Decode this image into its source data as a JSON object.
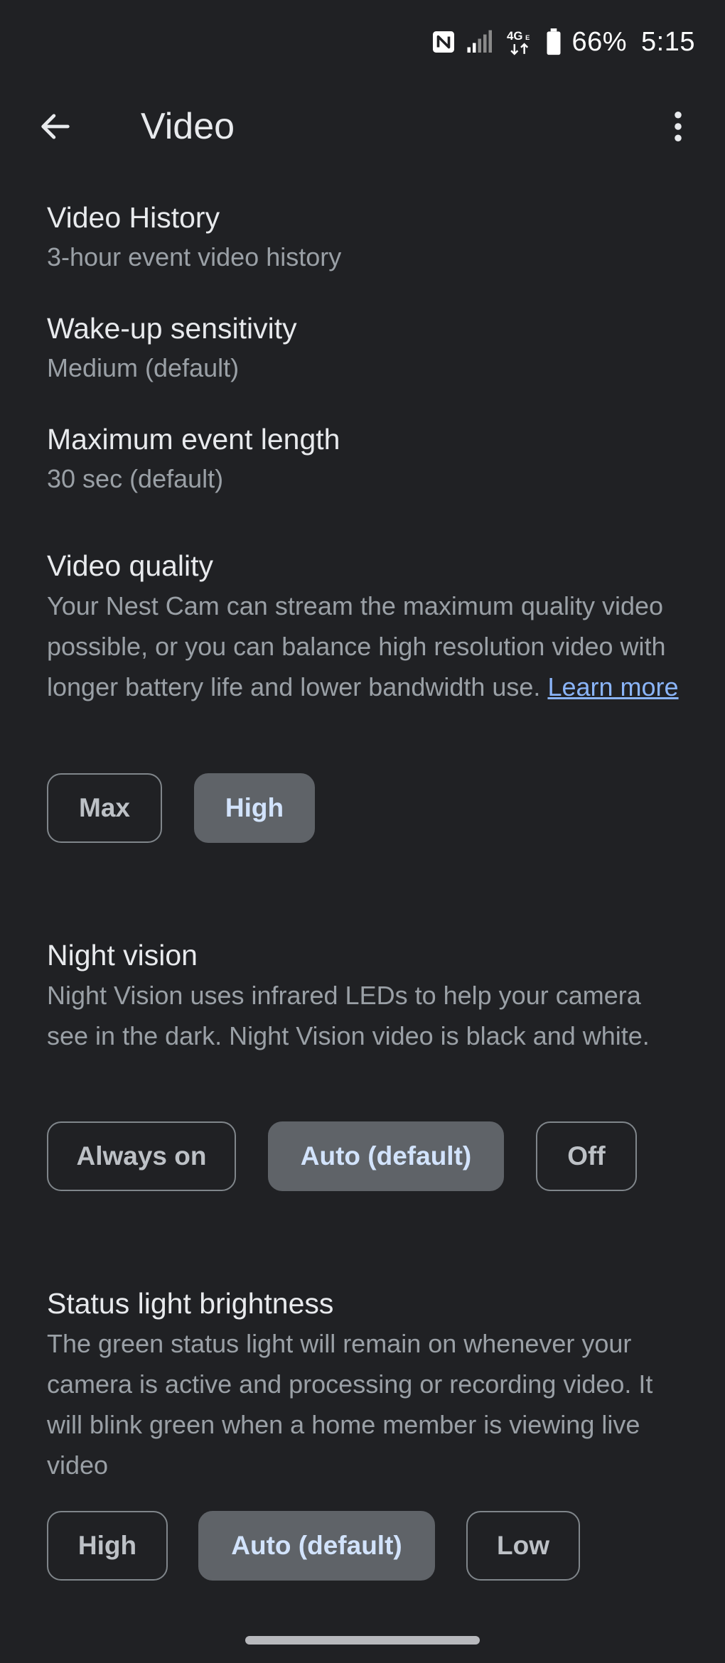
{
  "status_bar": {
    "battery": "66%",
    "time": "5:15",
    "network": "4G",
    "icons": [
      "nfc-icon",
      "signal-icon",
      "4g-icon",
      "battery-icon"
    ]
  },
  "app_bar": {
    "title": "Video",
    "back_icon": "arrow-left-icon",
    "more_icon": "more-vert-icon"
  },
  "settings": {
    "video_history": {
      "title": "Video History",
      "value": "3-hour event video history"
    },
    "wakeup_sensitivity": {
      "title": "Wake-up sensitivity",
      "value": "Medium (default)"
    },
    "max_event_length": {
      "title": "Maximum event length",
      "value": "30 sec (default)"
    },
    "video_quality": {
      "title": "Video quality",
      "description": "Your Nest Cam can stream the maximum quality video possible, or you can balance high resolution video with longer battery life and lower bandwidth use.",
      "link": "Learn more",
      "options": [
        "Max",
        "High"
      ],
      "selected": "High"
    },
    "night_vision": {
      "title": "Night vision",
      "description": "Night Vision uses infrared LEDs to help your camera see in the dark. Night Vision video is black and white.",
      "options": [
        "Always on",
        "Auto (default)",
        "Off"
      ],
      "selected": "Auto (default)"
    },
    "status_light": {
      "title": "Status light brightness",
      "description": "The green status light will remain on whenever your camera is active and processing or recording video. It will blink green when a home member is viewing live video",
      "options": [
        "High",
        "Auto (default)",
        "Low"
      ],
      "selected": "Auto (default)"
    }
  },
  "colors": {
    "background": "#202124",
    "primary_text": "#e8eaed",
    "secondary_text": "#9aa0a6",
    "link": "#8ab4f8",
    "selected_chip": "#5f6368"
  }
}
